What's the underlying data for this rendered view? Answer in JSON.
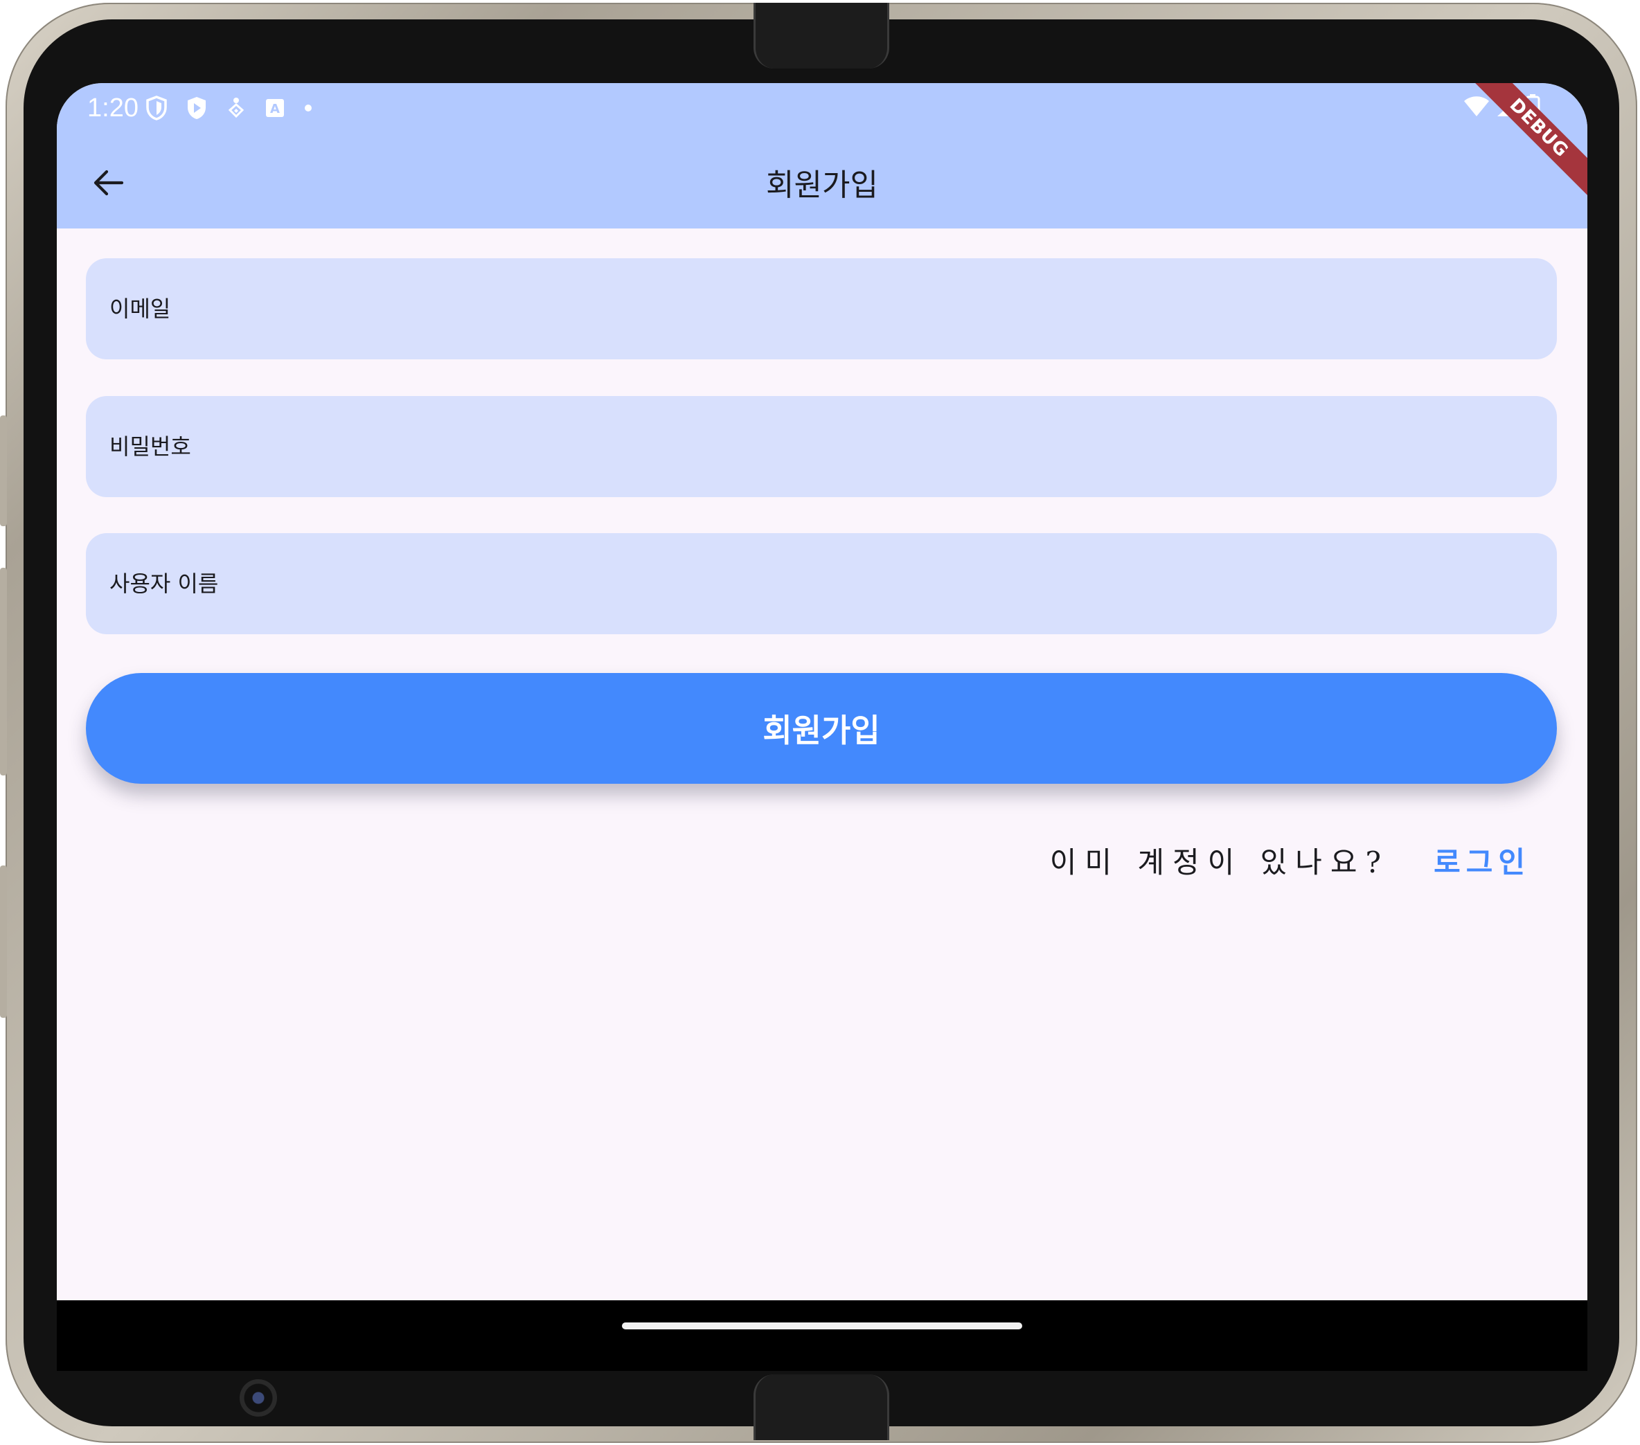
{
  "status_bar": {
    "time": "1:20",
    "left_icons": [
      "shield-icon",
      "play-protect-icon",
      "accessibility-icon",
      "translate-icon",
      "notification-dot-icon"
    ],
    "right_icons": [
      "wifi-icon",
      "signal-icon",
      "battery-icon"
    ]
  },
  "debug_banner": "DEBUG",
  "appbar": {
    "title": "회원가입",
    "back_icon": "back-arrow-icon"
  },
  "form": {
    "email_placeholder": "이메일",
    "password_placeholder": "비밀번호",
    "username_placeholder": "사용자 이름",
    "submit_label": "회원가입"
  },
  "login_row": {
    "prompt": "이미 계정이 있나요?",
    "link_label": "로그인"
  },
  "colors": {
    "appbar": "#b2c9ff",
    "field_fill": "#d8e0fd",
    "background": "#fbf5fc",
    "accent": "#4389fd",
    "debug_banner": "#a5353d"
  }
}
